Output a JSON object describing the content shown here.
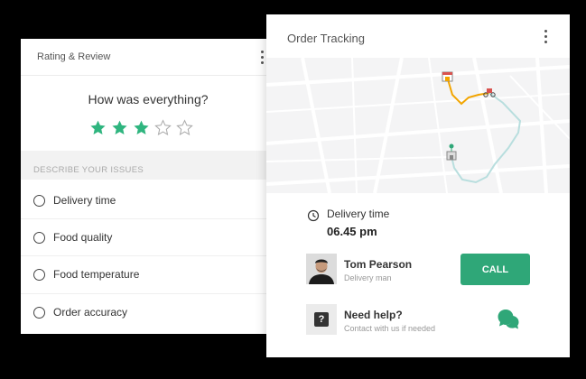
{
  "rating": {
    "title": "Rating & Review",
    "question": "How was everything?",
    "stars": {
      "filled": 3,
      "total": 5,
      "color": "#2fb57f"
    },
    "section_label": "DESCRIBE YOUR ISSUES",
    "issues": [
      {
        "label": "Delivery time"
      },
      {
        "label": "Food quality"
      },
      {
        "label": "Food temperature"
      },
      {
        "label": "Order accuracy"
      }
    ]
  },
  "order": {
    "title": "Order Tracking",
    "delivery": {
      "label": "Delivery time",
      "value": "06.45 pm"
    },
    "courier": {
      "name": "Tom Pearson",
      "role": "Delivery man"
    },
    "call_label": "CALL",
    "help": {
      "title": "Need help?",
      "subtitle": "Contact with us if needed"
    }
  },
  "colors": {
    "accent": "#2fa778",
    "route_orange": "#f2a500",
    "route_teal": "#b8dede"
  }
}
